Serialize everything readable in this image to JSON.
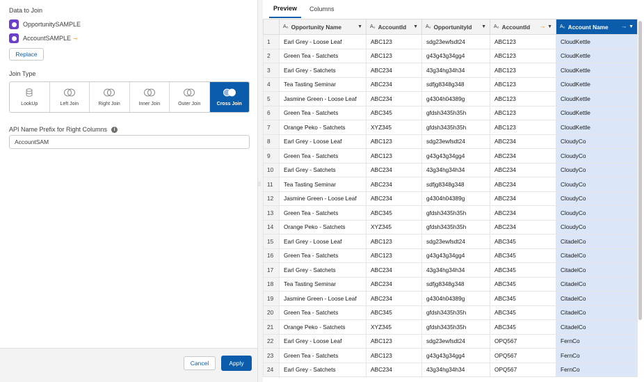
{
  "left": {
    "data_to_join_label": "Data to Join",
    "datasets": [
      {
        "name": "OpportunitySAMPLE",
        "join_mark": ""
      },
      {
        "name": "AccountSAMPLE",
        "join_mark": "⊸"
      }
    ],
    "replace_label": "Replace",
    "join_type_label": "Join Type",
    "join_types": [
      {
        "label": "LookUp",
        "icon": "lookup-icon"
      },
      {
        "label": "Left Join",
        "icon": "left-join-icon"
      },
      {
        "label": "Right Join",
        "icon": "right-join-icon"
      },
      {
        "label": "Inner Join",
        "icon": "inner-join-icon"
      },
      {
        "label": "Outer Join",
        "icon": "outer-join-icon"
      },
      {
        "label": "Cross Join",
        "icon": "cross-join-icon"
      }
    ],
    "active_join": "Cross Join",
    "prefix_label": "API Name Prefix for Right Columns",
    "prefix_value": "AccountSAM",
    "cancel_label": "Cancel",
    "apply_label": "Apply"
  },
  "right": {
    "tabs": [
      {
        "label": "Preview",
        "active": true
      },
      {
        "label": "Columns",
        "active": false
      }
    ],
    "columns": [
      {
        "label": "Opportunity Name",
        "type_icon": "A₀",
        "join_mark": "",
        "highlighted": false
      },
      {
        "label": "AccountId",
        "type_icon": "A₀",
        "join_mark": "",
        "highlighted": false
      },
      {
        "label": "OpportunityId",
        "type_icon": "A₀",
        "join_mark": "",
        "highlighted": false
      },
      {
        "label": "AccountId",
        "type_icon": "A₀",
        "join_mark": "⊸",
        "highlighted": false
      },
      {
        "label": "Account Name",
        "type_icon": "A₀",
        "join_mark": "⊸",
        "highlighted": true
      }
    ],
    "rows": [
      [
        "1",
        "Earl Grey - Loose Leaf",
        "ABC123",
        "sdg23ewfsdt24",
        "ABC123",
        "CloudKettle"
      ],
      [
        "2",
        "Green Tea - Satchets",
        "ABC123",
        "g43g43g34gg4",
        "ABC123",
        "CloudKettle"
      ],
      [
        "3",
        "Earl Grey - Satchets",
        "ABC234",
        "43g34hg34h34",
        "ABC123",
        "CloudKettle"
      ],
      [
        "4",
        "Tea Tasting Seminar",
        "ABC234",
        "sdfjg8348g348",
        "ABC123",
        "CloudKettle"
      ],
      [
        "5",
        "Jasmine Green - Loose Leaf",
        "ABC234",
        "g4304h04389g",
        "ABC123",
        "CloudKettle"
      ],
      [
        "6",
        "Green Tea - Satchets",
        "ABC345",
        "gfdsh3435h35h",
        "ABC123",
        "CloudKettle"
      ],
      [
        "7",
        "Orange Peko - Satchets",
        "XYZ345",
        "gfdsh3435h35h",
        "ABC123",
        "CloudKettle"
      ],
      [
        "8",
        "Earl Grey - Loose Leaf",
        "ABC123",
        "sdg23ewfsdt24",
        "ABC234",
        "CloudyCo"
      ],
      [
        "9",
        "Green Tea - Satchets",
        "ABC123",
        "g43g43g34gg4",
        "ABC234",
        "CloudyCo"
      ],
      [
        "10",
        "Earl Grey - Satchets",
        "ABC234",
        "43g34hg34h34",
        "ABC234",
        "CloudyCo"
      ],
      [
        "11",
        "Tea Tasting Seminar",
        "ABC234",
        "sdfjg8348g348",
        "ABC234",
        "CloudyCo"
      ],
      [
        "12",
        "Jasmine Green - Loose Leaf",
        "ABC234",
        "g4304h04389g",
        "ABC234",
        "CloudyCo"
      ],
      [
        "13",
        "Green Tea - Satchets",
        "ABC345",
        "gfdsh3435h35h",
        "ABC234",
        "CloudyCo"
      ],
      [
        "14",
        "Orange Peko - Satchets",
        "XYZ345",
        "gfdsh3435h35h",
        "ABC234",
        "CloudyCo"
      ],
      [
        "15",
        "Earl Grey - Loose Leaf",
        "ABC123",
        "sdg23ewfsdt24",
        "ABC345",
        "CitadelCo"
      ],
      [
        "16",
        "Green Tea - Satchets",
        "ABC123",
        "g43g43g34gg4",
        "ABC345",
        "CitadelCo"
      ],
      [
        "17",
        "Earl Grey - Satchets",
        "ABC234",
        "43g34hg34h34",
        "ABC345",
        "CitadelCo"
      ],
      [
        "18",
        "Tea Tasting Seminar",
        "ABC234",
        "sdfjg8348g348",
        "ABC345",
        "CitadelCo"
      ],
      [
        "19",
        "Jasmine Green - Loose Leaf",
        "ABC234",
        "g4304h04389g",
        "ABC345",
        "CitadelCo"
      ],
      [
        "20",
        "Green Tea - Satchets",
        "ABC345",
        "gfdsh3435h35h",
        "ABC345",
        "CitadelCo"
      ],
      [
        "21",
        "Orange Peko - Satchets",
        "XYZ345",
        "gfdsh3435h35h",
        "ABC345",
        "CitadelCo"
      ],
      [
        "22",
        "Earl Grey - Loose Leaf",
        "ABC123",
        "sdg23ewfsdt24",
        "OPQ567",
        "FernCo"
      ],
      [
        "23",
        "Green Tea - Satchets",
        "ABC123",
        "g43g43g34gg4",
        "OPQ567",
        "FernCo"
      ],
      [
        "24",
        "Earl Grey - Satchets",
        "ABC234",
        "43g34hg34h34",
        "OPQ567",
        "FernCo"
      ]
    ]
  },
  "colors": {
    "accent": "#0b5cab",
    "dataset_icon": "#6b3fc9",
    "join_mark": "#f0a030",
    "highlight_column": "#dbe7f9"
  }
}
